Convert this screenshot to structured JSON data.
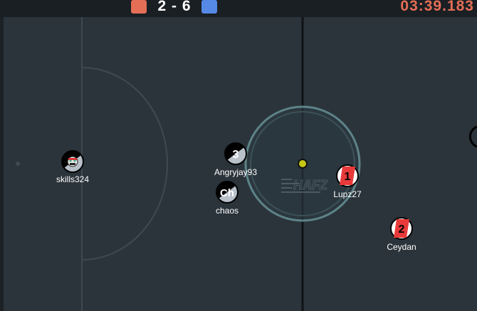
{
  "scoreboard": {
    "red_score": "2",
    "separator": "-",
    "blue_score": "6",
    "score_text": "2 - 6",
    "timer": "03:39.183",
    "colors": {
      "red": "#e56e56",
      "blue": "#5689e5"
    }
  },
  "field": {
    "logo_text": "HAFZ",
    "colors": {
      "grass": "#2b343b",
      "lines": "#3e4a53",
      "center_line": "#0f1215",
      "kickoff_circle": "#5d8388",
      "ball": "#c6c614"
    }
  },
  "players": [
    {
      "name": "skills324",
      "avatar": "emoji-face-icon",
      "team": "blue"
    },
    {
      "name": "Angryjay93",
      "avatar": "3",
      "team": "blue"
    },
    {
      "name": "chaos",
      "avatar": "Ch",
      "team": "blue"
    },
    {
      "name": "Lupz27",
      "avatar": "1",
      "team": "red"
    },
    {
      "name": "Ceydan",
      "avatar": "2",
      "team": "red"
    }
  ]
}
